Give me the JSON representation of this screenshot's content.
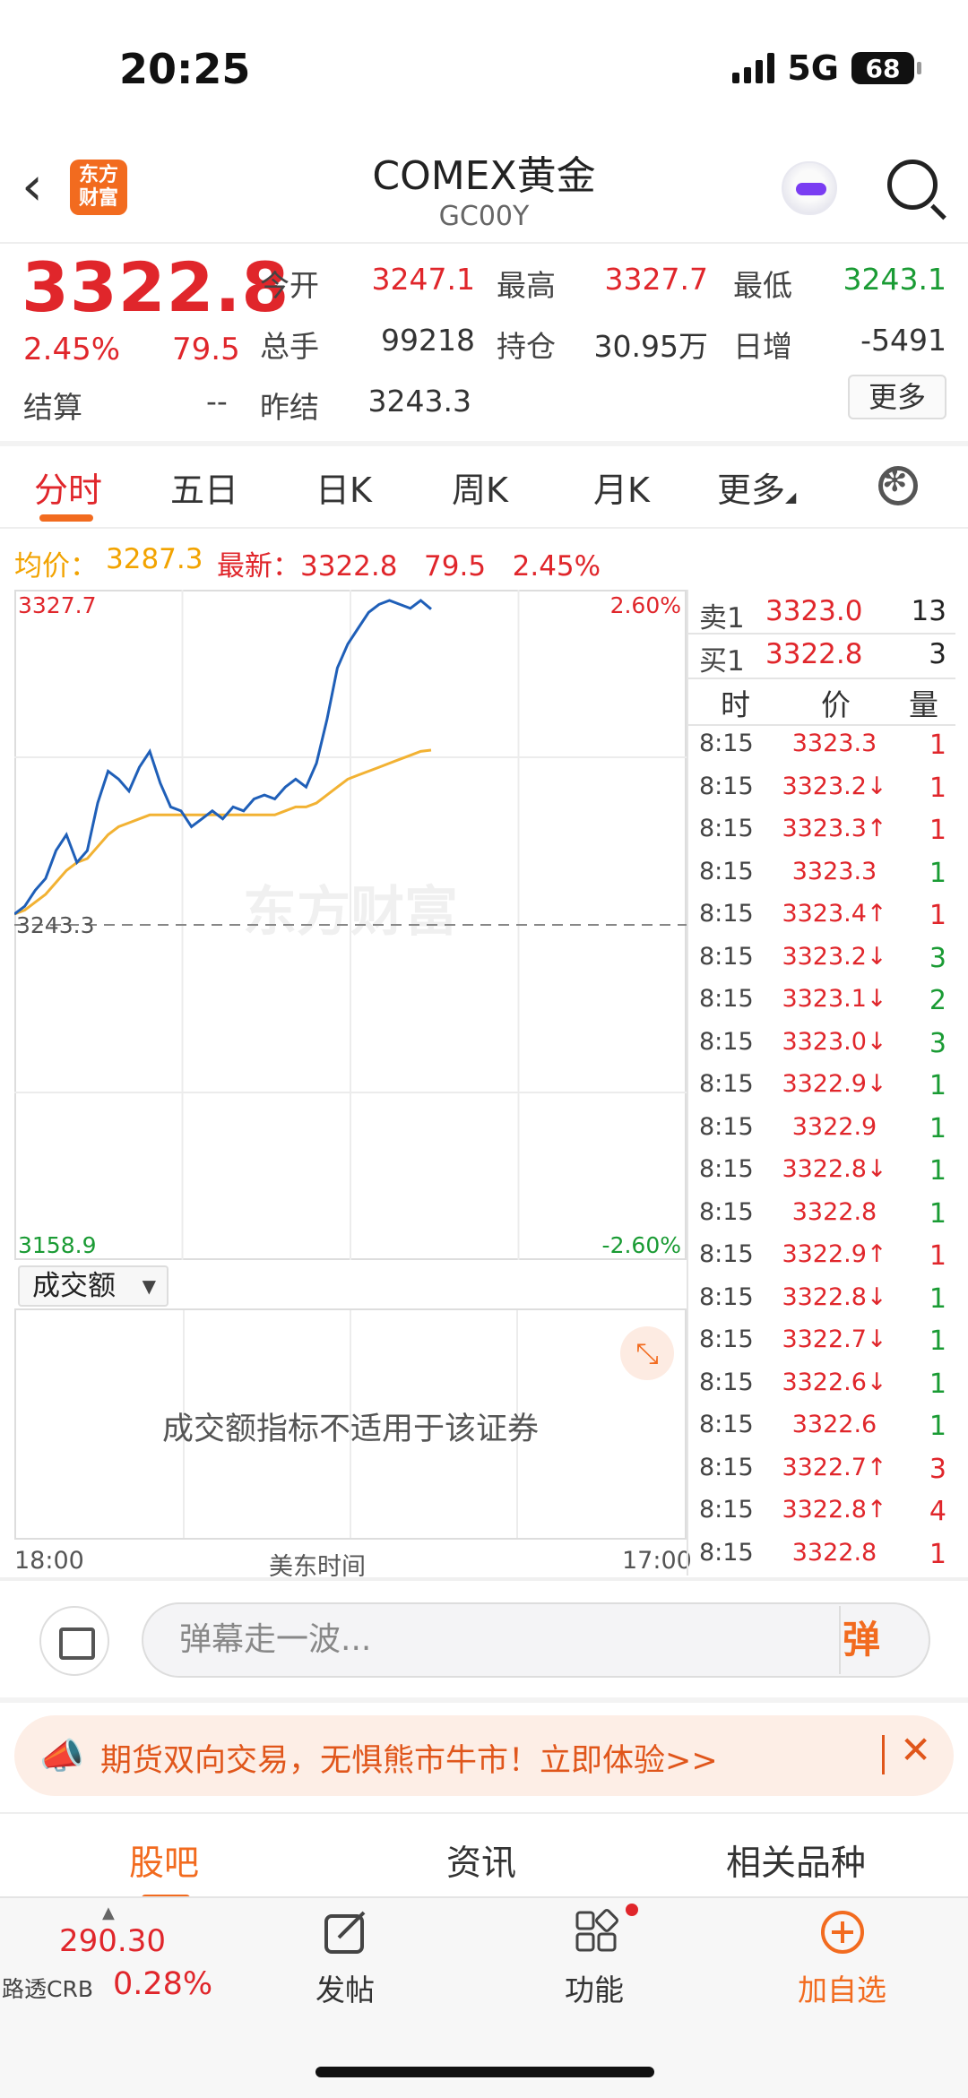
{
  "status_bar": {
    "time": "20:25",
    "network": "5G",
    "battery": "68"
  },
  "header": {
    "back": "‹",
    "logo": "东方\n财富",
    "title": "COMEX黄金",
    "code": "GC00Y"
  },
  "quote": {
    "price": "3322.8",
    "pct": "2.45%",
    "change": "79.5",
    "settle_label": "结算",
    "settle_value": "--",
    "open_label": "今开",
    "open_value": "3247.1",
    "high_label": "最高",
    "high_value": "3327.7",
    "low_label": "最低",
    "low_value": "3243.1",
    "vol_label": "总手",
    "vol_value": "99218",
    "oi_label": "持仓",
    "oi_value": "30.95万",
    "inc_label": "日增",
    "inc_value": "-5491",
    "prev_label": "昨结",
    "prev_value": "3243.3",
    "more_label": "更多"
  },
  "tabs": [
    "分时",
    "五日",
    "日K",
    "周K",
    "月K",
    "更多"
  ],
  "info_line": {
    "avg_label": "均价：",
    "avg_value": "3287.3",
    "latest": "最新：3322.8   79.5   2.45%"
  },
  "chart_data": {
    "type": "line",
    "ylim": [
      3158.9,
      3327.7
    ],
    "y_labels": {
      "top": "3327.7",
      "bottom": "3158.9",
      "ref": "3243.3",
      "top_pct": "2.60%",
      "bottom_pct": "-2.60%"
    },
    "x_labels": [
      "18:00",
      "美东时间",
      "17:00"
    ],
    "series": [
      {
        "values": [
          3246,
          3248,
          3252,
          3255,
          3262,
          3266,
          3259,
          3262,
          3274,
          3282,
          3280,
          3277,
          3283,
          3287,
          3279,
          3273,
          3272,
          3268,
          3270,
          3272,
          3270,
          3273,
          3272,
          3275,
          3276,
          3275,
          3278,
          3280,
          3278,
          3284,
          3295,
          3308,
          3314,
          3318,
          3322,
          3324,
          3325,
          3324,
          3323,
          3325,
          3322.8
        ],
        "color": "#1f5fb8"
      },
      {
        "values": [
          3246,
          3247,
          3249,
          3251,
          3254,
          3257,
          3259,
          3260,
          3263,
          3266,
          3268,
          3269,
          3270,
          3271,
          3271,
          3271,
          3271,
          3271,
          3271,
          3271,
          3271,
          3271,
          3271,
          3271,
          3271,
          3271,
          3272,
          3273,
          3273,
          3274,
          3276,
          3278,
          3280,
          3281,
          3282,
          3283,
          3284,
          3285,
          3286,
          3287,
          3287.3
        ],
        "color": "#f2b233"
      }
    ],
    "watermark": "东方财富"
  },
  "volume": {
    "select_label": "成交额",
    "message": "成交额指标不适用于该证券"
  },
  "order_book": {
    "sell": {
      "label": "卖1",
      "price": "3323.0",
      "vol": "13"
    },
    "buy": {
      "label": "买1",
      "price": "3322.8",
      "vol": "3"
    },
    "headers": [
      "时",
      "价",
      "量"
    ],
    "ticks": [
      {
        "time": "8:15",
        "price": "3323.3",
        "vol": "1",
        "pc": "red",
        "vc": "red"
      },
      {
        "time": "8:15",
        "price": "3323.2↓",
        "vol": "1",
        "pc": "red",
        "vc": "red"
      },
      {
        "time": "8:15",
        "price": "3323.3↑",
        "vol": "1",
        "pc": "red",
        "vc": "red"
      },
      {
        "time": "8:15",
        "price": "3323.3",
        "vol": "1",
        "pc": "red",
        "vc": "green"
      },
      {
        "time": "8:15",
        "price": "3323.4↑",
        "vol": "1",
        "pc": "red",
        "vc": "red"
      },
      {
        "time": "8:15",
        "price": "3323.2↓",
        "vol": "3",
        "pc": "red",
        "vc": "green"
      },
      {
        "time": "8:15",
        "price": "3323.1↓",
        "vol": "2",
        "pc": "red",
        "vc": "green"
      },
      {
        "time": "8:15",
        "price": "3323.0↓",
        "vol": "3",
        "pc": "red",
        "vc": "green"
      },
      {
        "time": "8:15",
        "price": "3322.9↓",
        "vol": "1",
        "pc": "red",
        "vc": "green"
      },
      {
        "time": "8:15",
        "price": "3322.9",
        "vol": "1",
        "pc": "red",
        "vc": "green"
      },
      {
        "time": "8:15",
        "price": "3322.8↓",
        "vol": "1",
        "pc": "red",
        "vc": "green"
      },
      {
        "time": "8:15",
        "price": "3322.8",
        "vol": "1",
        "pc": "red",
        "vc": "green"
      },
      {
        "time": "8:15",
        "price": "3322.9↑",
        "vol": "1",
        "pc": "red",
        "vc": "red"
      },
      {
        "time": "8:15",
        "price": "3322.8↓",
        "vol": "1",
        "pc": "red",
        "vc": "green"
      },
      {
        "time": "8:15",
        "price": "3322.7↓",
        "vol": "1",
        "pc": "red",
        "vc": "green"
      },
      {
        "time": "8:15",
        "price": "3322.6↓",
        "vol": "1",
        "pc": "red",
        "vc": "green"
      },
      {
        "time": "8:15",
        "price": "3322.6",
        "vol": "1",
        "pc": "red",
        "vc": "green"
      },
      {
        "time": "8:15",
        "price": "3322.7↑",
        "vol": "3",
        "pc": "red",
        "vc": "red"
      },
      {
        "time": "8:15",
        "price": "3322.8↑",
        "vol": "4",
        "pc": "red",
        "vc": "red"
      },
      {
        "time": "8:15",
        "price": "3322.8",
        "vol": "1",
        "pc": "red",
        "vc": "red"
      }
    ]
  },
  "danmu": {
    "placeholder": "弹幕走一波...",
    "send": "弹"
  },
  "promo": {
    "text": "期货双向交易，无惧熊市牛市！立即体验>>",
    "close": "✕"
  },
  "bottom_tabs": [
    "股吧",
    "资讯",
    "相关品种"
  ],
  "bottom_bar": {
    "crb_value": "290.30",
    "crb_name": "路透CRB",
    "crb_pct": "0.28%",
    "actions": [
      "发帖",
      "功能",
      "加自选"
    ]
  },
  "colors": {
    "up": "#e0262b",
    "down": "#1a9b34",
    "accent": "#f26b1f",
    "avg": "#f2a300"
  }
}
